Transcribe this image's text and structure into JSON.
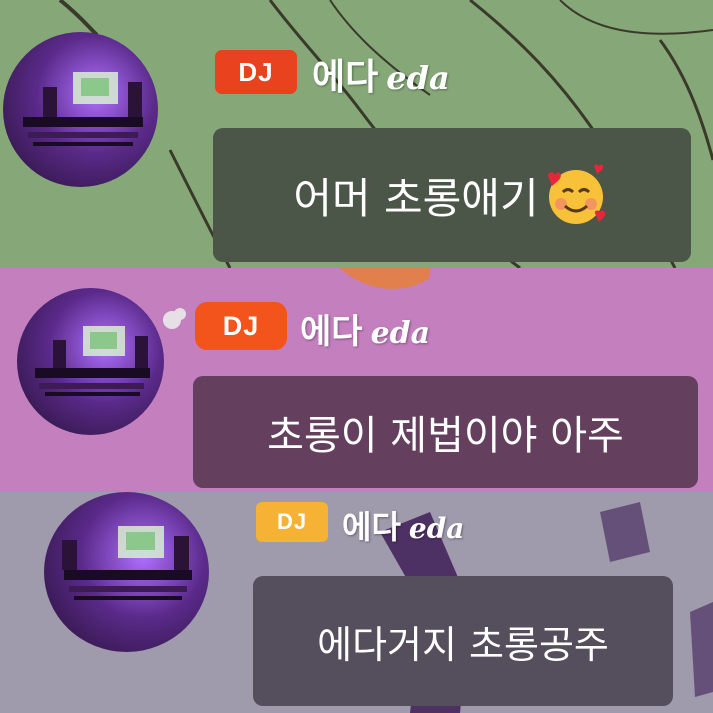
{
  "messages": [
    {
      "badge": "DJ",
      "name": "에다",
      "name_en": "eda",
      "text": "어머 초롱애기",
      "badge_color": "#e8421f",
      "bubble_color": "#4b5548",
      "background": "#86a878",
      "emoji": "smiling-face-with-hearts"
    },
    {
      "badge": "DJ",
      "name": "에다",
      "name_en": "eda",
      "text": "초롱이 제법이야 아주",
      "badge_color": "#f2541c",
      "bubble_color": "#64405e",
      "background": "#c47fbe"
    },
    {
      "badge": "DJ",
      "name": "에다",
      "name_en": "eda",
      "text": "에다거지 초롱공주",
      "badge_color": "#f5b235",
      "bubble_color": "#544e5d",
      "background": "#9f9aac"
    }
  ]
}
